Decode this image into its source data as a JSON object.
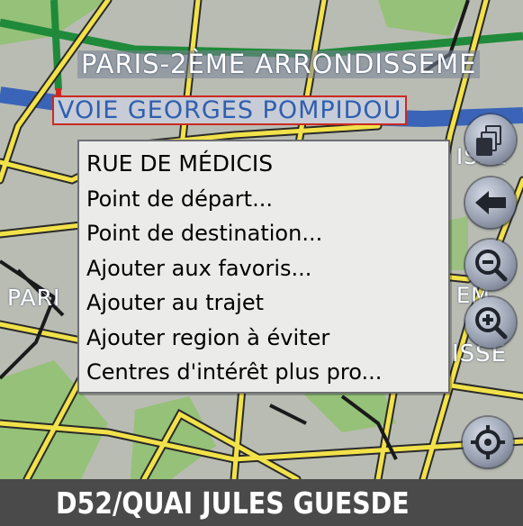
{
  "map": {
    "labels": {
      "arrondissement": "PARIS-2ÈME ARRONDISSEME",
      "highlighted_street": "VOIE GEORGES POMPIDOU",
      "left_partial": "PARI",
      "right_partial_1": "ISSE",
      "right_partial_2": "EM",
      "right_partial_3": "ISSE"
    },
    "colors": {
      "road": "#f2e24a",
      "primary_road": "#1f8a3a",
      "water": "#3a64b7",
      "park": "#8ec26d",
      "highlight": "#cc2a1f"
    }
  },
  "context_menu": {
    "title": "RUE DE MÉDICIS",
    "items": [
      "Point de départ...",
      "Point de destination...",
      "Ajouter aux favoris...",
      "Ajouter au trajet",
      "Ajouter region à éviter",
      "Centres d'intérêt plus pro..."
    ]
  },
  "side_buttons": {
    "copy": "copy-icon",
    "back": "arrow-left-icon",
    "zoom_out": "zoom-out-icon",
    "zoom_in": "zoom-in-icon",
    "locate": "crosshair-icon"
  },
  "status_bar": {
    "road_name": "D52/QUAI JULES GUESDE"
  }
}
